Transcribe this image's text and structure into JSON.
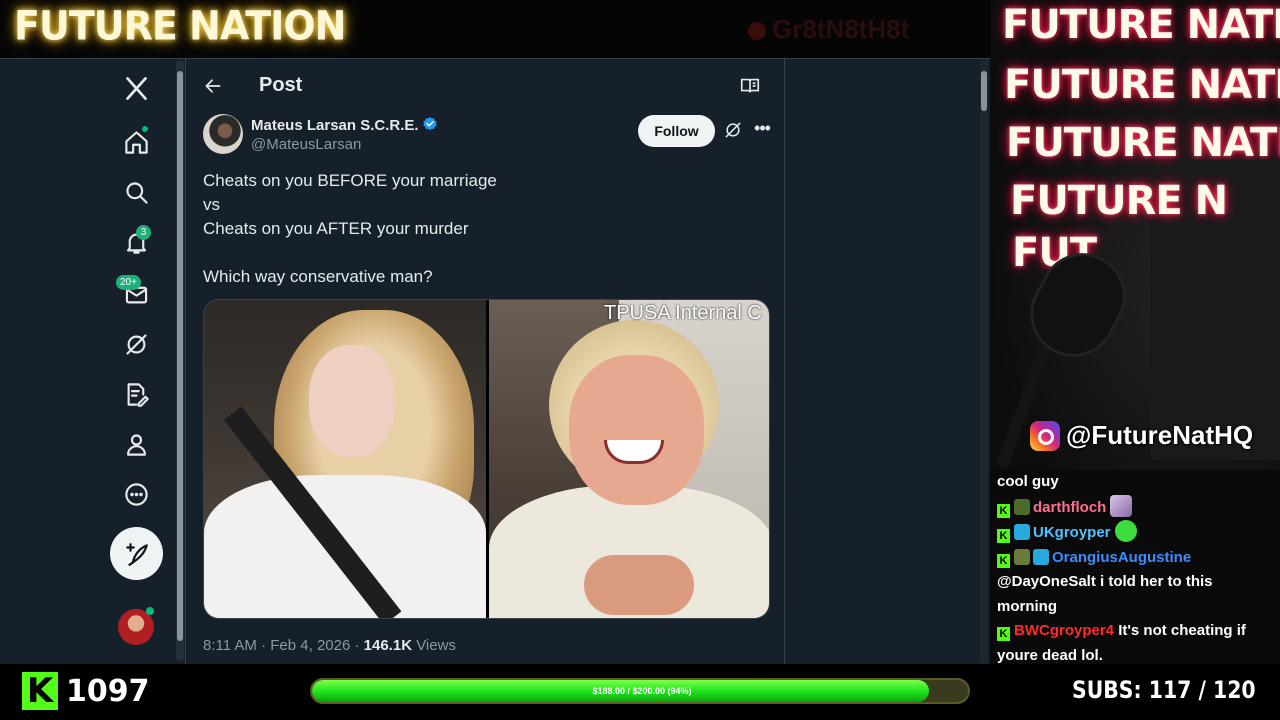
{
  "stream": {
    "brand": "FUTURE NATION",
    "ghost_name": "Gr8tN8tH8t",
    "neon_sign": [
      "FUTURE NATION",
      "FUTURE NATION",
      "FUTURE NATION",
      "FUTURE N",
      "FUT"
    ],
    "instagram_handle": "@FutureNatHQ",
    "viewer_count": "1097",
    "goal": {
      "text": "$188.00 / $200.00 (94%)",
      "fraction": 0.94
    },
    "subs": "SUBS:  117 / 120"
  },
  "sidebar": {
    "notification_count": "3",
    "messages_count": "20+"
  },
  "post": {
    "title": "Post",
    "author_name": "Mateus Larsan S.C.R.E.",
    "author_handle": "@MateusLarsan",
    "follow_label": "Follow",
    "text_lines": [
      "Cheats on you BEFORE your marriage",
      "vs",
      "Cheats on you AFTER your murder",
      "",
      "Which way conservative man?"
    ],
    "media_watermark": "TPUSA Internal C",
    "time": "8:11 AM · Feb 4, 2026 · ",
    "views_count": "146.1K",
    "views_label": " Views"
  },
  "chat": {
    "messages": [
      {
        "user": "",
        "text": "cool guy"
      },
      {
        "user": "darthfloch",
        "text": ""
      },
      {
        "user": "UKgroyper",
        "text": ""
      },
      {
        "user": "OrangiusAugustine",
        "text": ""
      },
      {
        "user": "",
        "text": "@DayOneSalt i told her to this morning"
      },
      {
        "user": "BWCgroyper4",
        "text": "It's not cheating if youre dead lol."
      }
    ]
  },
  "colors": {
    "x_bg": "#15202b",
    "kick_green": "#53fc18",
    "darthfloch": "#ff6f91",
    "ukgroyper": "#4fc3ff",
    "orangius": "#3b8cff",
    "bwcgroyper": "#ff2a2a"
  }
}
